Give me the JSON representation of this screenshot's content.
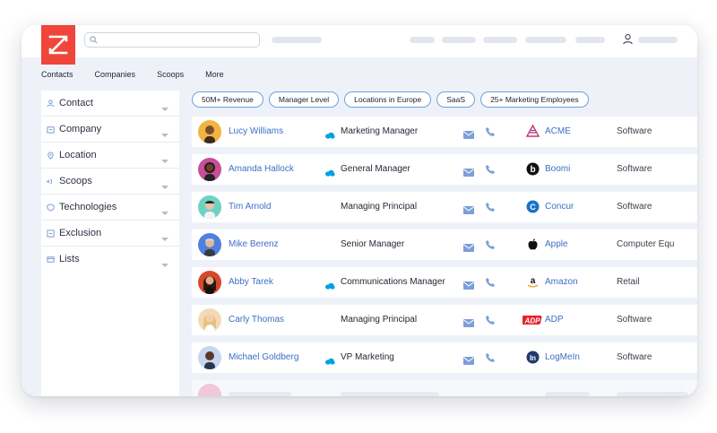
{
  "search": {
    "placeholder": "",
    "value": ""
  },
  "tabs": [
    {
      "label": "Contacts"
    },
    {
      "label": "Companies"
    },
    {
      "label": "Scoops"
    },
    {
      "label": "More"
    }
  ],
  "sidebar": {
    "filters": [
      {
        "label": "Contact",
        "icon": "contact-icon"
      },
      {
        "label": "Company",
        "icon": "company-icon"
      },
      {
        "label": "Location",
        "icon": "location-pin-icon"
      },
      {
        "label": "Scoops",
        "icon": "scoops-icon"
      },
      {
        "label": "Technologies",
        "icon": "shield-icon"
      },
      {
        "label": "Exclusion",
        "icon": "exclusion-icon"
      },
      {
        "label": "Lists",
        "icon": "list-icon"
      }
    ]
  },
  "chips": [
    {
      "label": "50M+ Revenue"
    },
    {
      "label": "Manager Level"
    },
    {
      "label": "Locations in Europe"
    },
    {
      "label": "SaaS"
    },
    {
      "label": "25+ Marketing Employees"
    }
  ],
  "contacts": [
    {
      "name": "Lucy Williams",
      "title": "Marketing Manager",
      "company": "ACME",
      "industry": "Software",
      "salesforce": true,
      "company_logo": "acme-logo-icon"
    },
    {
      "name": "Amanda Hallock",
      "title": "General Manager",
      "company": "Boomi",
      "industry": "Software",
      "salesforce": true,
      "company_logo": "boomi-logo-icon"
    },
    {
      "name": "Tim Arnold",
      "title": "Managing Principal",
      "company": "Concur",
      "industry": "Software",
      "salesforce": false,
      "company_logo": "concur-logo-icon"
    },
    {
      "name": "Mike Berenz",
      "title": "Senior Manager",
      "company": "Apple",
      "industry": "Computer Equ",
      "salesforce": false,
      "company_logo": "apple-logo-icon"
    },
    {
      "name": "Abby Tarek",
      "title": "Communications Manager",
      "company": "Amazon",
      "industry": "Retail",
      "salesforce": true,
      "company_logo": "amazon-logo-icon"
    },
    {
      "name": "Carly Thomas",
      "title": "Managing Principal",
      "company": "ADP",
      "industry": "Software",
      "salesforce": false,
      "company_logo": "adp-logo-icon"
    },
    {
      "name": "Michael Goldberg",
      "title": "VP Marketing",
      "company": "LogMeIn",
      "industry": "Software",
      "salesforce": true,
      "company_logo": "logmein-logo-icon"
    }
  ],
  "colors": {
    "brand": "#f0453a",
    "link": "#3d6fc4",
    "salesforce": "#00a1e0",
    "icon_blue": "#6b93d6"
  }
}
